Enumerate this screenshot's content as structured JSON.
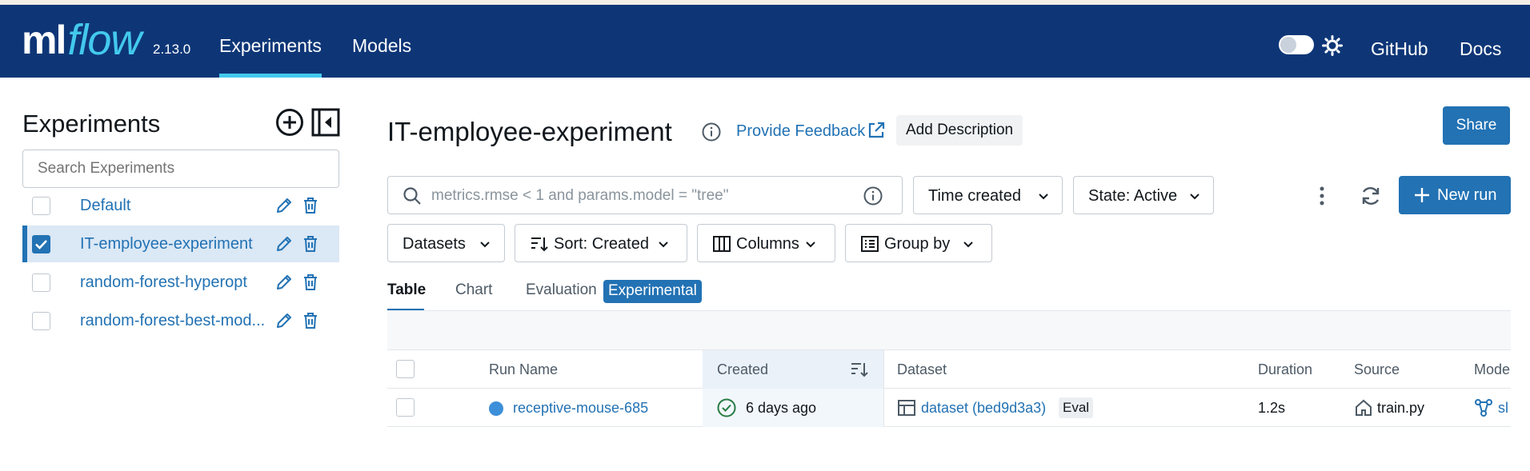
{
  "navbar": {
    "logo_ml": "ml",
    "logo_flow": "flow",
    "version": "2.13.0",
    "tabs": [
      {
        "label": "Experiments",
        "active": true
      },
      {
        "label": "Models",
        "active": false
      }
    ],
    "theme_toggle": "off",
    "links": [
      {
        "label": "GitHub"
      },
      {
        "label": "Docs"
      }
    ],
    "accent_color": "#43c9ed",
    "background_color": "#0e3677"
  },
  "sidebar": {
    "title": "Experiments",
    "search_placeholder": "Search Experiments",
    "items": [
      {
        "label": "Default",
        "checked": false,
        "selected": false
      },
      {
        "label": "IT-employee-experiment",
        "checked": true,
        "selected": true
      },
      {
        "label": "random-forest-hyperopt",
        "checked": false,
        "selected": false
      },
      {
        "label": "random-forest-best-mod...",
        "checked": false,
        "selected": false
      }
    ]
  },
  "header": {
    "title": "IT-employee-experiment",
    "feedback_label": "Provide Feedback",
    "add_description_label": "Add Description",
    "share_label": "Share"
  },
  "filters": {
    "search_placeholder": "metrics.rmse < 1 and params.model = \"tree\"",
    "time_created_label": "Time created",
    "state_label": "State: Active",
    "datasets_label": "Datasets",
    "sort_label": "Sort: Created",
    "columns_label": "Columns",
    "group_by_label": "Group by",
    "new_run_label": "New run"
  },
  "view_tabs": {
    "table": "Table",
    "chart": "Chart",
    "evaluation": "Evaluation",
    "experimental_badge": "Experimental",
    "active": "Table"
  },
  "table": {
    "headers": {
      "run_name": "Run Name",
      "created": "Created",
      "dataset": "Dataset",
      "duration": "Duration",
      "source": "Source",
      "models": "Mode"
    },
    "rows": [
      {
        "run_name": "receptive-mouse-685",
        "run_color": "#3d8fd9",
        "created": "6 days ago",
        "dataset": "dataset (bed9d3a3)",
        "dataset_tag": "Eval",
        "duration": "1.2s",
        "source": "train.py",
        "model": "sl"
      }
    ]
  }
}
